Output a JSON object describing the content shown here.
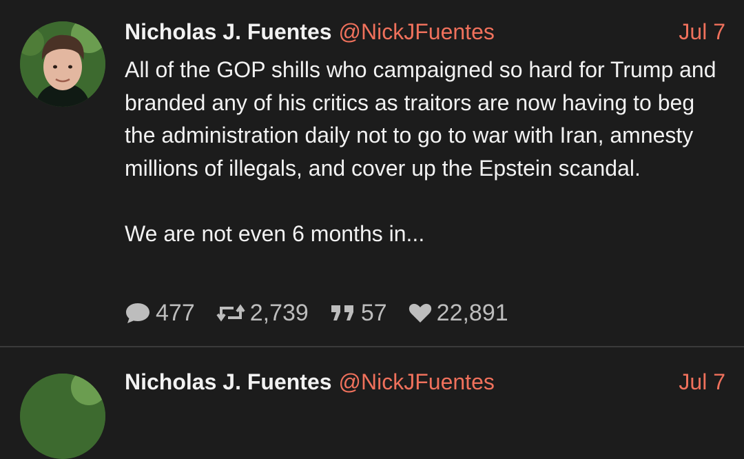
{
  "tweets": [
    {
      "display_name": "Nicholas J. Fuentes",
      "handle": "@NickJFuentes",
      "date": "Jul 7",
      "paragraphs": [
        "All of the GOP shills who campaigned so hard for Trump and branded any of his critics as traitors are now having to beg the administration daily not to go to war with Iran, amnesty millions of illegals, and cover up the Epstein scandal.",
        "We are not even 6 months in..."
      ],
      "stats": {
        "replies": "477",
        "retweets": "2,739",
        "quotes": "57",
        "likes": "22,891"
      },
      "icons": [
        "comment-icon",
        "retweet-icon",
        "quote-icon",
        "heart-icon"
      ]
    },
    {
      "display_name": "Nicholas J. Fuentes",
      "handle": "@NickJFuentes",
      "date": "Jul 7"
    }
  ],
  "colors": {
    "background": "#1c1c1c",
    "accent": "#f0715c",
    "text": "#f2f2f2",
    "muted": "#bdbdbd",
    "divider": "#3a3a3a"
  }
}
